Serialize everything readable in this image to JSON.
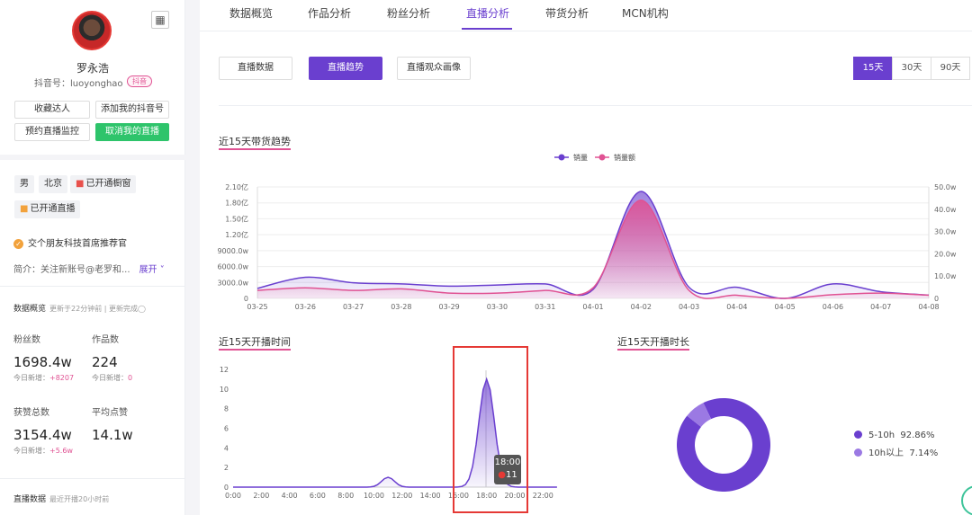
{
  "profile": {
    "name": "罗永浩",
    "uid": "抖音号：luoyonghao",
    "badge": "抖音",
    "buttons": {
      "collect": "收藏达人",
      "add": "添加我的抖音号",
      "monitor": "预约直播监控",
      "cancel": "取消我的直播"
    },
    "tags": {
      "gender": "男",
      "city": "北京",
      "window": "已开通橱窗",
      "live": "已开通直播"
    },
    "recommend": "交个朋友科技首席推荐官",
    "intro": "简介：关注新账号@老罗和...",
    "intro_more": "展开 ˅",
    "overview": {
      "title": "数据概览",
      "updated": "更新于22分钟前 | 更新完成◯",
      "fans_label": "粉丝数",
      "fans": "1698.4w",
      "fans_delta_label": "今日新增：",
      "fans_delta": "+8207",
      "works_label": "作品数",
      "works": "224",
      "works_delta_label": "今日新增：",
      "works_delta": "0",
      "likes_label": "获赞总数",
      "likes": "3154.4w",
      "likes_delta_label": "今日新增：",
      "likes_delta": "+5.6w",
      "avg_label": "平均点赞",
      "avg": "14.1w"
    },
    "live_title": "直播数据",
    "live_sub": "最近开播20小时前"
  },
  "tabs": [
    "数据概览",
    "作品分析",
    "粉丝分析",
    "直播分析",
    "带货分析",
    "MCN机构"
  ],
  "subbuttons": [
    "直播数据",
    "直播趋势",
    "直播观众画像"
  ],
  "range": [
    "15天",
    "30天",
    "90天"
  ],
  "chart_colors": {
    "primary": "#6a3fcf",
    "pink": "#e05293"
  },
  "chart_data": [
    {
      "type": "area",
      "title": "近15天带货趋势",
      "x": [
        "03-25",
        "03-26",
        "03-27",
        "03-28",
        "03-29",
        "03-30",
        "03-31",
        "04-01",
        "04-02",
        "04-03",
        "04-04",
        "04-05",
        "04-06",
        "04-07",
        "04-08"
      ],
      "y_left_ticks": [
        "0",
        "3000.0w",
        "6000.0w",
        "9000.0w",
        "1.20亿",
        "1.50亿",
        "1.80亿",
        "2.10亿"
      ],
      "y_right_ticks": [
        "0",
        "10.0w",
        "20.0w",
        "30.0w",
        "40.0w",
        "50.0w"
      ],
      "series": [
        {
          "name": "销量",
          "axis": "right",
          "values": [
            4.5,
            9.5,
            7,
            6.5,
            5.5,
            6,
            6.5,
            4,
            48,
            5,
            5,
            0,
            6.5,
            3,
            1.5
          ]
        },
        {
          "name": "销量额",
          "axis": "left",
          "values": [
            1500,
            2000,
            1500,
            1800,
            1000,
            1000,
            1500,
            2000,
            18500,
            1500,
            600,
            0,
            700,
            1000,
            600
          ]
        }
      ],
      "ylim_left": [
        0,
        21000
      ],
      "ylim_right": [
        0,
        50
      ]
    },
    {
      "type": "area",
      "title": "近15天开播时间",
      "x": [
        "0:00",
        "2:00",
        "4:00",
        "6:00",
        "8:00",
        "10:00",
        "12:00",
        "14:00",
        "16:00",
        "18:00",
        "20:00",
        "22:00"
      ],
      "y_ticks": [
        "0",
        "2",
        "4",
        "6",
        "8",
        "10",
        "12"
      ],
      "ylim": [
        0,
        12
      ],
      "peaks": [
        {
          "hour": 11,
          "value": 1
        },
        {
          "hour": 18,
          "value": 11
        }
      ],
      "tooltip": {
        "time": "18:00",
        "value": "11"
      }
    },
    {
      "type": "pie",
      "title": "近15天开播时长",
      "slices": [
        {
          "label": "5-10h",
          "value": 92.86,
          "display": "92.86%"
        },
        {
          "label": "10h以上",
          "value": 7.14,
          "display": "7.14%"
        }
      ]
    }
  ]
}
